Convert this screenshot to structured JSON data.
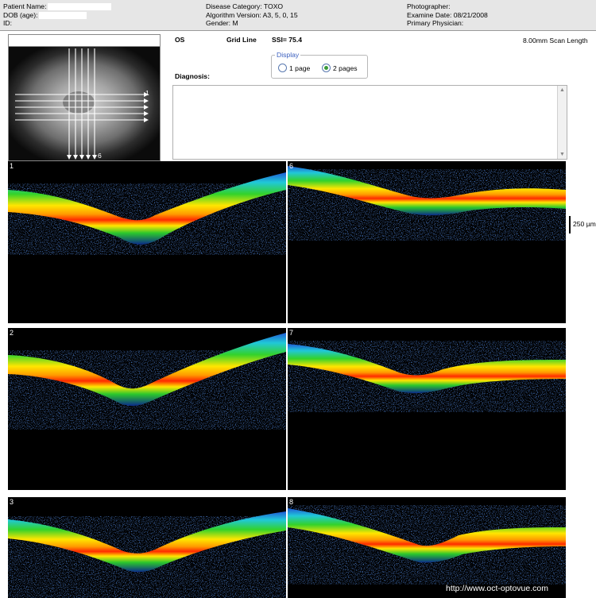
{
  "header": {
    "col1": {
      "patient_name": "Patient Name:",
      "dob": "DOB (age):",
      "id": "ID:"
    },
    "col2": {
      "disease_category": "Disease Category: TOXO",
      "algorithm_version": "Algorithm Version: A3, 5, 0, 15",
      "gender": "Gender: M"
    },
    "col3": {
      "photographer": "Photographer:",
      "exam_date": "Examine Date: 08/21/2008",
      "primary_physician": "Primary Physician:"
    }
  },
  "exam": {
    "eye": "OS",
    "protocol": "Grid Line",
    "ssi": "SSI= 75.4",
    "scan_length": "8.00mm Scan Length"
  },
  "display": {
    "legend": "Display",
    "options": [
      {
        "label": "1 page",
        "selected": false
      },
      {
        "label": "2 pages",
        "selected": true
      }
    ]
  },
  "diagnosis": {
    "label": "Diagnosis:",
    "value": ""
  },
  "fundus": {
    "h_line_label": "1",
    "v_line_label": "6"
  },
  "scans": [
    {
      "label": "1"
    },
    {
      "label": "6"
    },
    {
      "label": "2"
    },
    {
      "label": "7"
    },
    {
      "label": "3"
    },
    {
      "label": "8"
    }
  ],
  "scale": {
    "label": "250 µm"
  },
  "watermark": "http://www.oct-optovue.com",
  "colors": {
    "header_bg": "#e6e6e6",
    "accent": "#3a5fbf",
    "retina_outer": "#2a6bd8",
    "retina_mid": "#2bcf2b",
    "retina_warm": "#ffe600",
    "retina_hot": "#ff3a00"
  }
}
